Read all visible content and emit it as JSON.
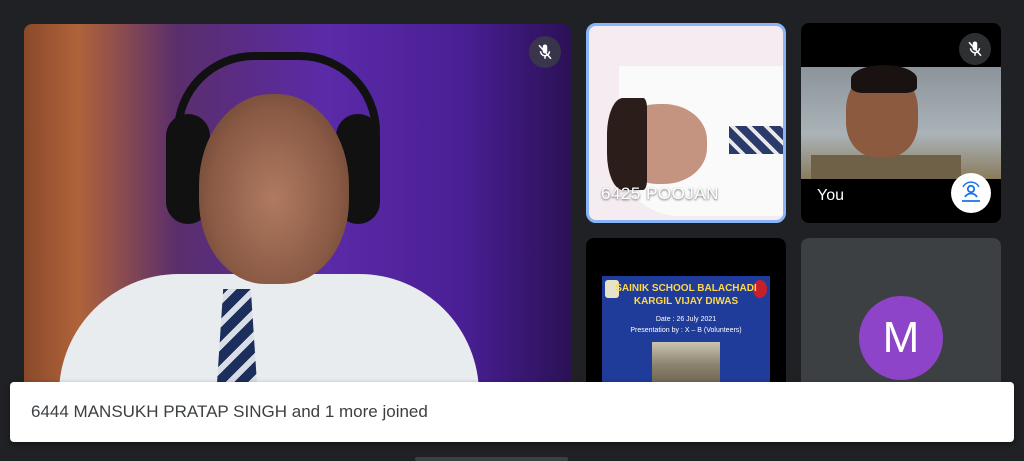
{
  "participants": {
    "main": {
      "muted": true
    },
    "poojan": {
      "name": "6425 POOJAN",
      "active_speaker": true
    },
    "self": {
      "name": "You",
      "muted": true
    },
    "slide": {
      "title_line1": "SAINIK SCHOOL BALACHADI",
      "title_line2": "KARGIL VIJAY DIWAS",
      "date_line": "Date : 26 July 2021",
      "presentation_line": "Presentation by : X – B (Volunteers)"
    },
    "avatar_tile": {
      "initial": "M",
      "color": "#8e44c8"
    }
  },
  "toast": {
    "message": "6444 MANSUKH PRATAP SINGH and 1 more joined"
  },
  "icons": {
    "mute": "mic-off-icon",
    "effects": "visual-effects-icon"
  },
  "colors": {
    "background": "#202124",
    "active_border": "#8ab4f8"
  }
}
